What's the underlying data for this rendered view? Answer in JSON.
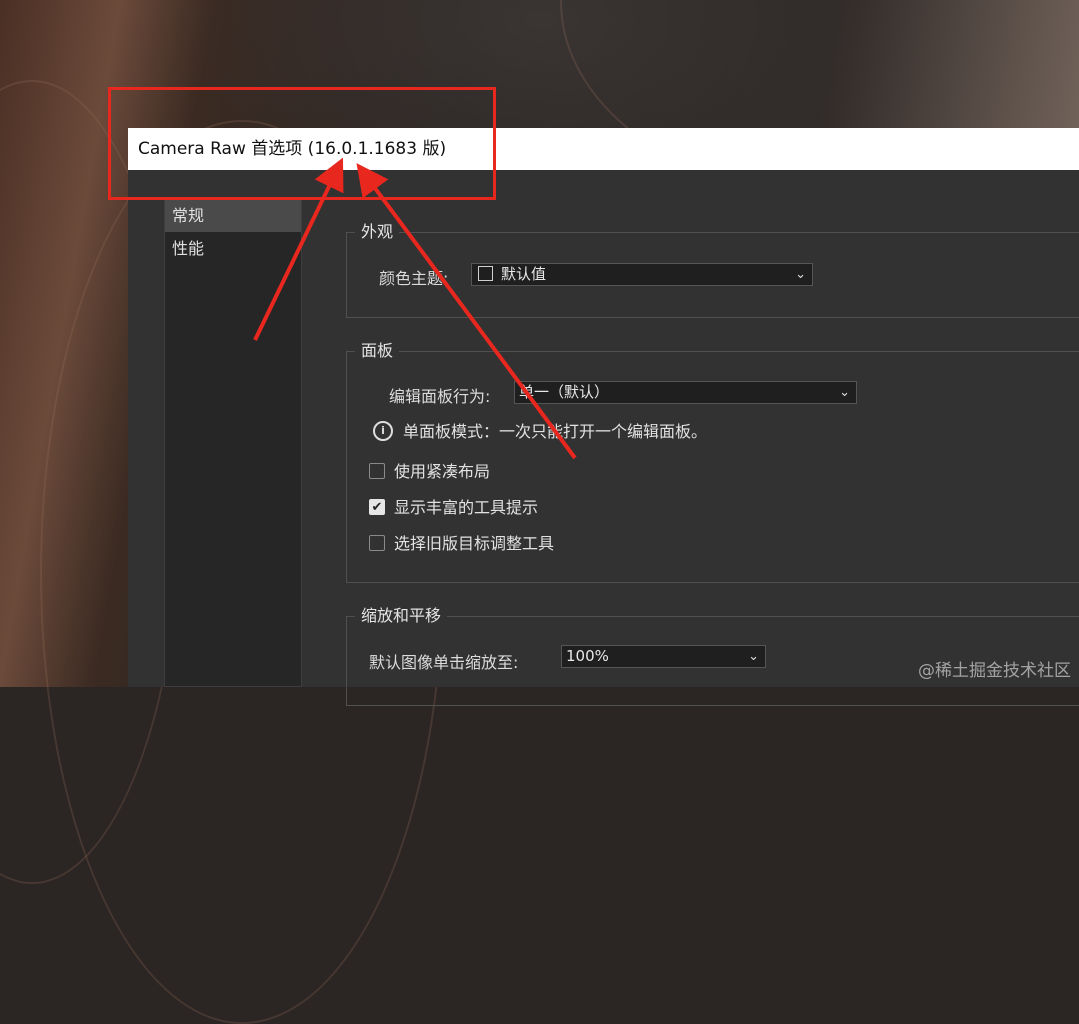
{
  "window": {
    "title": "Camera Raw 首选项  (16.0.1.1683 版)"
  },
  "sidebar": {
    "items": [
      {
        "label": "常规",
        "active": true
      },
      {
        "label": "性能",
        "active": false
      }
    ]
  },
  "appearance": {
    "title": "外观",
    "color_theme_label": "颜色主题:",
    "color_theme_value": "默认值"
  },
  "panels": {
    "title": "面板",
    "edit_panel_behavior_label": "编辑面板行为:",
    "edit_panel_behavior_value": "单一（默认）",
    "info_text": "单面板模式：一次只能打开一个编辑面板。",
    "checkboxes": [
      {
        "label": "使用紧凑布局",
        "checked": false
      },
      {
        "label": "显示丰富的工具提示",
        "checked": true
      },
      {
        "label": "选择旧版目标调整工具",
        "checked": false
      }
    ]
  },
  "zoom_pan": {
    "title": "缩放和平移",
    "default_zoom_label": "默认图像单击缩放至:",
    "default_zoom_value": "100%"
  },
  "watermark": "@稀土掘金技术社区",
  "colors": {
    "annotation": "#e8271e",
    "dialog_bg": "#323232"
  },
  "icons": {
    "dropdown": "chevron-down-icon",
    "info": "info-icon",
    "check": "checkmark-icon"
  }
}
